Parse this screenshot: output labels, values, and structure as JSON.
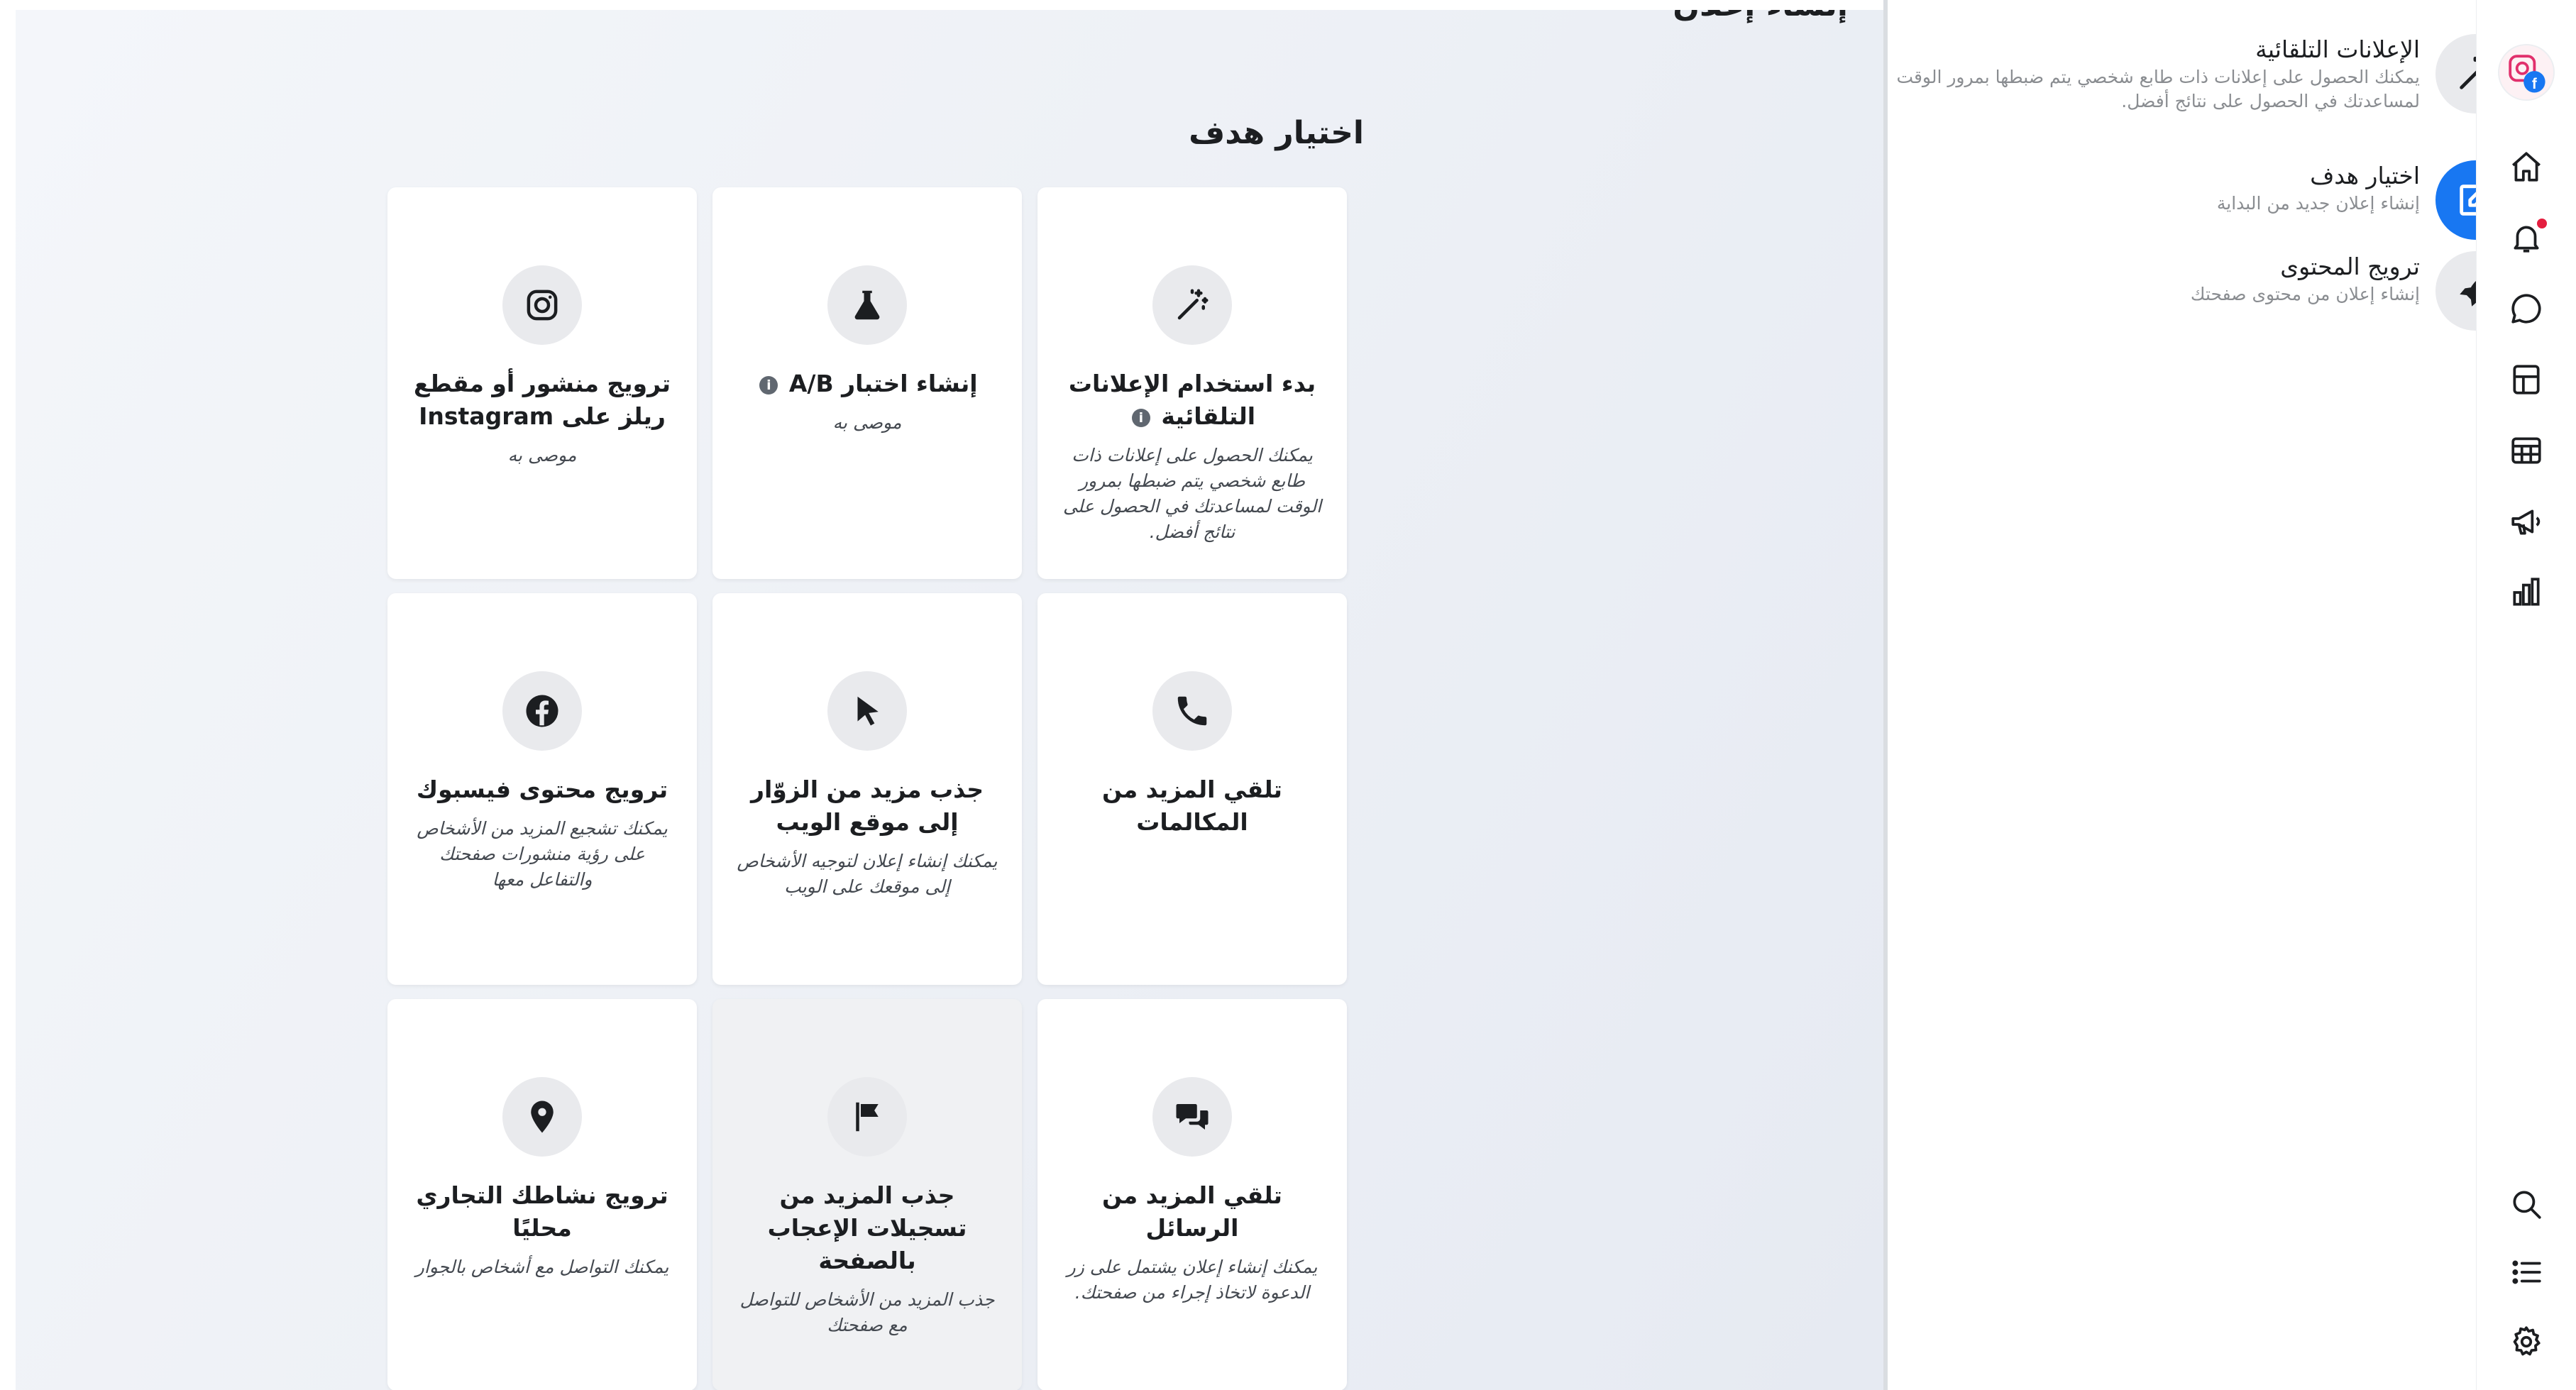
{
  "header": {
    "title": "إنشاء إعلان"
  },
  "main": {
    "section_title": "اختيار هدف",
    "cards": [
      {
        "title": "بدء استخدام الإعلانات التلقائية",
        "subtitle": "يمكنك الحصول على إعلانات ذات طابع شخصي يتم ضبطها بمرور الوقت لمساعدتك في الحصول على نتائج أفضل.",
        "icon": "magic-wand-icon"
      },
      {
        "title": "إنشاء اختبار A/B",
        "subtitle": "موصى به",
        "icon": "beaker-icon"
      },
      {
        "title": "ترويج منشور أو مقطع ريلز على Instagram",
        "subtitle": "موصى به",
        "icon": "instagram-icon"
      },
      {
        "title": "تلقي المزيد من المكالمات",
        "subtitle": "",
        "icon": "phone-icon"
      },
      {
        "title": "جذب مزيد من الزوّار إلى موقع الويب",
        "subtitle": "يمكنك إنشاء إعلان لتوجيه الأشخاص إلى موقعك على الويب",
        "icon": "cursor-icon"
      },
      {
        "title": "ترويج محتوى فيسبوك",
        "subtitle": "يمكنك تشجيع المزيد من الأشخاص على رؤية منشورات صفحتك والتفاعل معها",
        "icon": "facebook-icon"
      },
      {
        "title": "تلقي المزيد من الرسائل",
        "subtitle": "يمكنك إنشاء إعلان يشتمل على زر الدعوة لاتخاذ إجراء من صفحتك.",
        "icon": "chat-bubbles-icon"
      },
      {
        "title": "جذب المزيد من تسجيلات الإعجاب بالصفحة",
        "subtitle": "جذب المزيد من الأشخاص للتواصل مع صفحتك",
        "icon": "flag-icon"
      },
      {
        "title": "ترويج نشاطك التجاري محليًا",
        "subtitle": "يمكنك التواصل مع أشخاص بالجوار",
        "icon": "location-pin-icon"
      }
    ]
  },
  "sidebar": {
    "options": [
      {
        "title": "الإعلانات التلقائية",
        "subtitle": "يمكنك الحصول على إعلانات ذات طابع شخصي يتم ضبطها بمرور الوقت لمساعدتك في الحصول على نتائج أفضل.",
        "icon": "magic-wand-icon",
        "active": false
      },
      {
        "title": "اختيار هدف",
        "subtitle": "إنشاء إعلان جديد من البداية",
        "icon": "edit-icon",
        "active": true
      },
      {
        "title": "ترويج المحتوى",
        "subtitle": "إنشاء إعلان من محتوى صفحتك",
        "icon": "rocket-icon",
        "active": false
      }
    ]
  },
  "rail": {
    "items": [
      "home-icon",
      "bell-icon",
      "chat-icon",
      "pages-icon",
      "table-icon",
      "megaphone-icon",
      "chart-icon",
      "search-icon",
      "list-icon",
      "gear-icon"
    ]
  },
  "colors": {
    "accent": "#1877f2",
    "icon_bg": "#e9eaed",
    "notification": "#e41e3f"
  }
}
